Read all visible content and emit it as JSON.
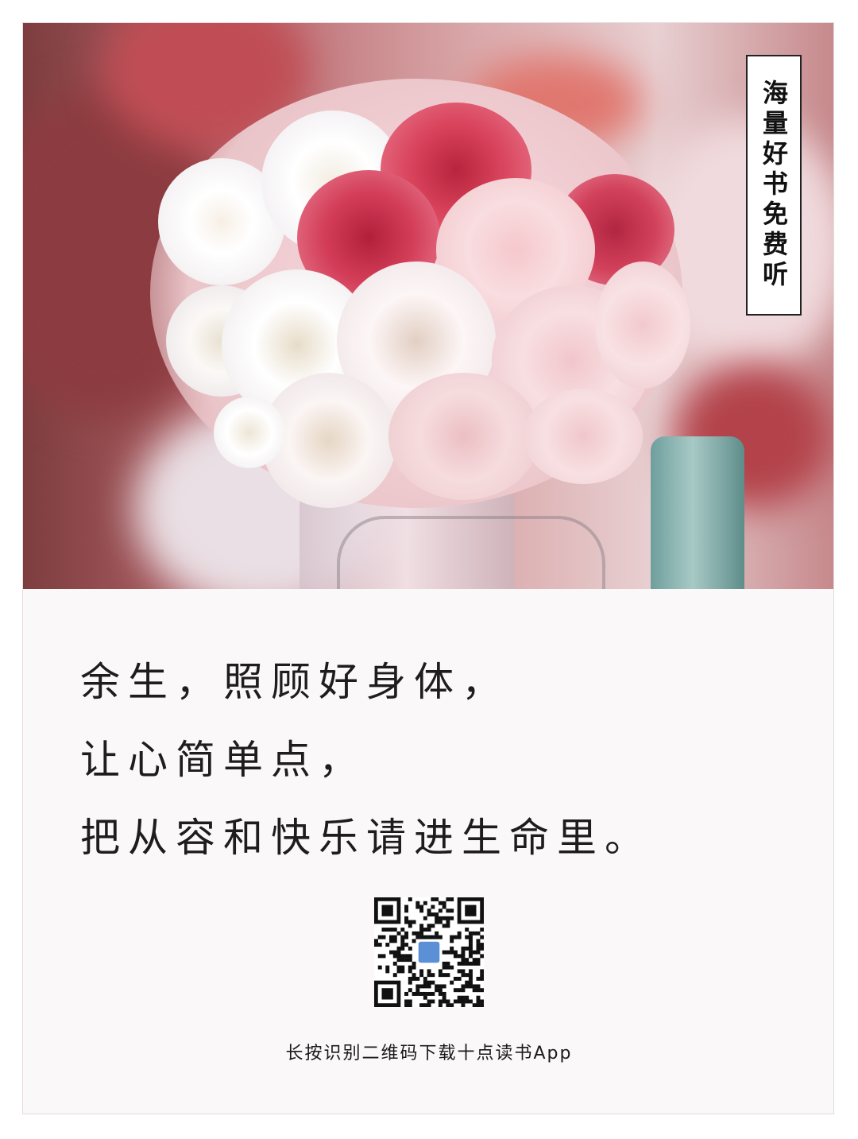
{
  "badge": {
    "text": "海量好书免费听"
  },
  "quote": {
    "lines": [
      "余生，照顾好身体，",
      "让心简单点，",
      "把从容和快乐请进生命里。"
    ]
  },
  "qr": {
    "center_icon": "app-logo-icon"
  },
  "footer": {
    "text": "长按识别二维码下载十点读书App"
  },
  "colors": {
    "text": "#1d1d1d",
    "badge_border": "#222222",
    "card_bg": "#fbf8f9"
  }
}
